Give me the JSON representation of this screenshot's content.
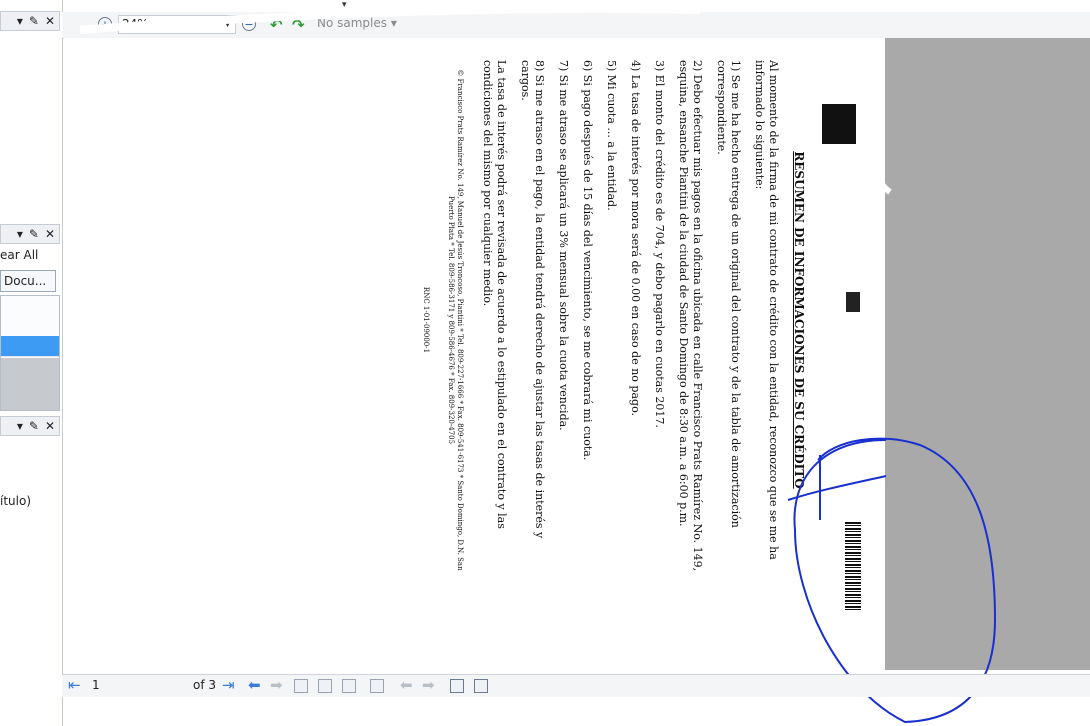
{
  "toolbar": {
    "zoom_value": "24%",
    "samples_label": "No samples",
    "zoom_in_label": "+",
    "zoom_out_label": "−",
    "undo_icon": "undo-icon",
    "redo_icon": "redo-icon"
  },
  "left_panel": {
    "clear_all_label": "ear All",
    "doc_tab_label": "Docu...",
    "titulo_label": "ítulo)"
  },
  "document": {
    "heading": "RESUMEN DE INFORMACIONES DE SU CRÉDITO",
    "intro": "Al momento de la firma de mi contrato de crédito con la entidad, reconozco que se me ha informado lo siguiente:",
    "items": [
      "1) Se me ha hecho entrega de un original del contrato y de la tabla de amortización correspondiente.",
      "2) Debo efectuar mis pagos en la oficina ubicada en calle Francisco Prats Ramírez No. 149, esquina, ensanche Piantini de la ciudad de Santo Domingo de 8:30 a.m. a 6:00 p.m.",
      "3) El monto del crédito es de 704, y debo pagarlo en cuotas 2017.",
      "4) La tasa de interés por mora será de 0.00 en caso de no pago.",
      "5) Mi cuota ... a la entidad.",
      "6) Si pago después de 15 días del vencimiento, se me cobrará mi cuota.",
      "7) Si me atraso se aplicará un 3% mensual sobre la cuota vencida.",
      "8) Si me atraso en el pago, la entidad tendrá derecho de ajustar las tasas de interés y cargos.",
      "La tasa de interés podrá ser revisada de acuerdo a lo estipulado en el contrato y las condiciones del mismo por cualquier medio."
    ],
    "footer": "© Francisco Prats Ramírez No. 149, Manuel de Jesús Troncoso, Piantini * Tel. 809-227-1666 * Fax. 809-541-6173 * Santo Domingo, D.N. San Puerto Plata * Tel. 809-586-3171 y 809-586-4676 * Fax. 809-320-4705",
    "rnc": "RNC 1-01-09000-1",
    "page_background": "#ffffff",
    "gray_background": "#a9a9a9"
  },
  "bottombar": {
    "page_value": "1",
    "page_total": "of 3"
  },
  "colors": {
    "accent": "#3d9bf3",
    "annotation": "#1a2fcf",
    "green_arrow": "#2f9a3a"
  }
}
